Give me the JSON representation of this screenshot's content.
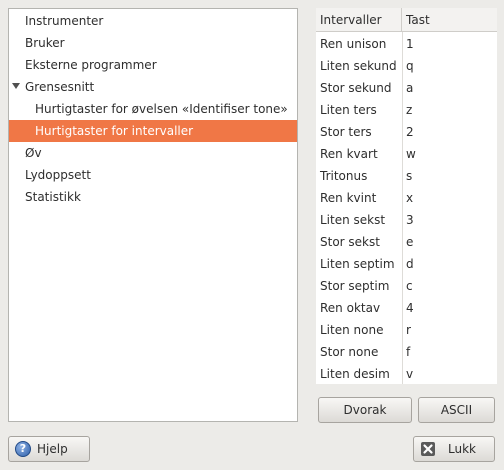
{
  "tree": {
    "items": [
      {
        "label": "Instrumenter"
      },
      {
        "label": "Bruker"
      },
      {
        "label": "Eksterne programmer"
      },
      {
        "label": "Grensesnitt",
        "expanded": true
      },
      {
        "label": "Hurtigtaster for øvelsen «Identifiser tone»"
      },
      {
        "label": "Hurtigtaster for intervaller",
        "selected": true
      },
      {
        "label": "Øv"
      },
      {
        "label": "Lydoppsett"
      },
      {
        "label": "Statistikk"
      }
    ]
  },
  "table": {
    "columns": [
      "Intervaller",
      "Tast"
    ],
    "rows": [
      [
        "Ren unison",
        "1"
      ],
      [
        "Liten sekund",
        "q"
      ],
      [
        "Stor sekund",
        "a"
      ],
      [
        "Liten ters",
        "z"
      ],
      [
        "Stor ters",
        "2"
      ],
      [
        "Ren kvart",
        "w"
      ],
      [
        "Tritonus",
        "s"
      ],
      [
        "Ren kvint",
        "x"
      ],
      [
        "Liten sekst",
        "3"
      ],
      [
        "Stor sekst",
        "e"
      ],
      [
        "Liten septim",
        "d"
      ],
      [
        "Stor septim",
        "c"
      ],
      [
        "Ren oktav",
        "4"
      ],
      [
        "Liten none",
        "r"
      ],
      [
        "Stor none",
        "f"
      ],
      [
        "Liten desim",
        "v"
      ]
    ]
  },
  "buttons": {
    "dvorak": "Dvorak",
    "ascii": "ASCII",
    "help": "Hjelp",
    "close": "Lukk"
  },
  "colors": {
    "selection": "#f07746",
    "window_bg": "#ecebe8"
  },
  "icons": {
    "help": "help-icon",
    "close": "close-icon",
    "expander": "expander-arrow-icon"
  }
}
